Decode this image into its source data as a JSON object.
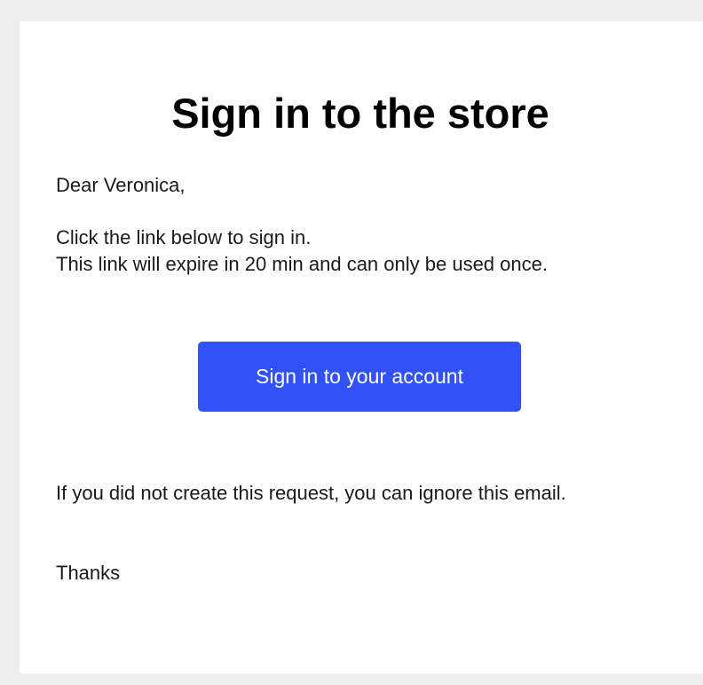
{
  "email": {
    "title": "Sign in to the store",
    "greeting": "Dear Veronica,",
    "instructions": {
      "line1": "Click the link below to sign in.",
      "line2": "This link will expire in 20 min and can only be used once."
    },
    "button_label": "Sign in to your account",
    "ignore_note": "If you did not create this request, you can ignore this email.",
    "signoff": "Thanks"
  },
  "colors": {
    "page_background": "#eeeeee",
    "card_background": "#ffffff",
    "button_background": "#3052f6",
    "button_text": "#ffffff"
  }
}
